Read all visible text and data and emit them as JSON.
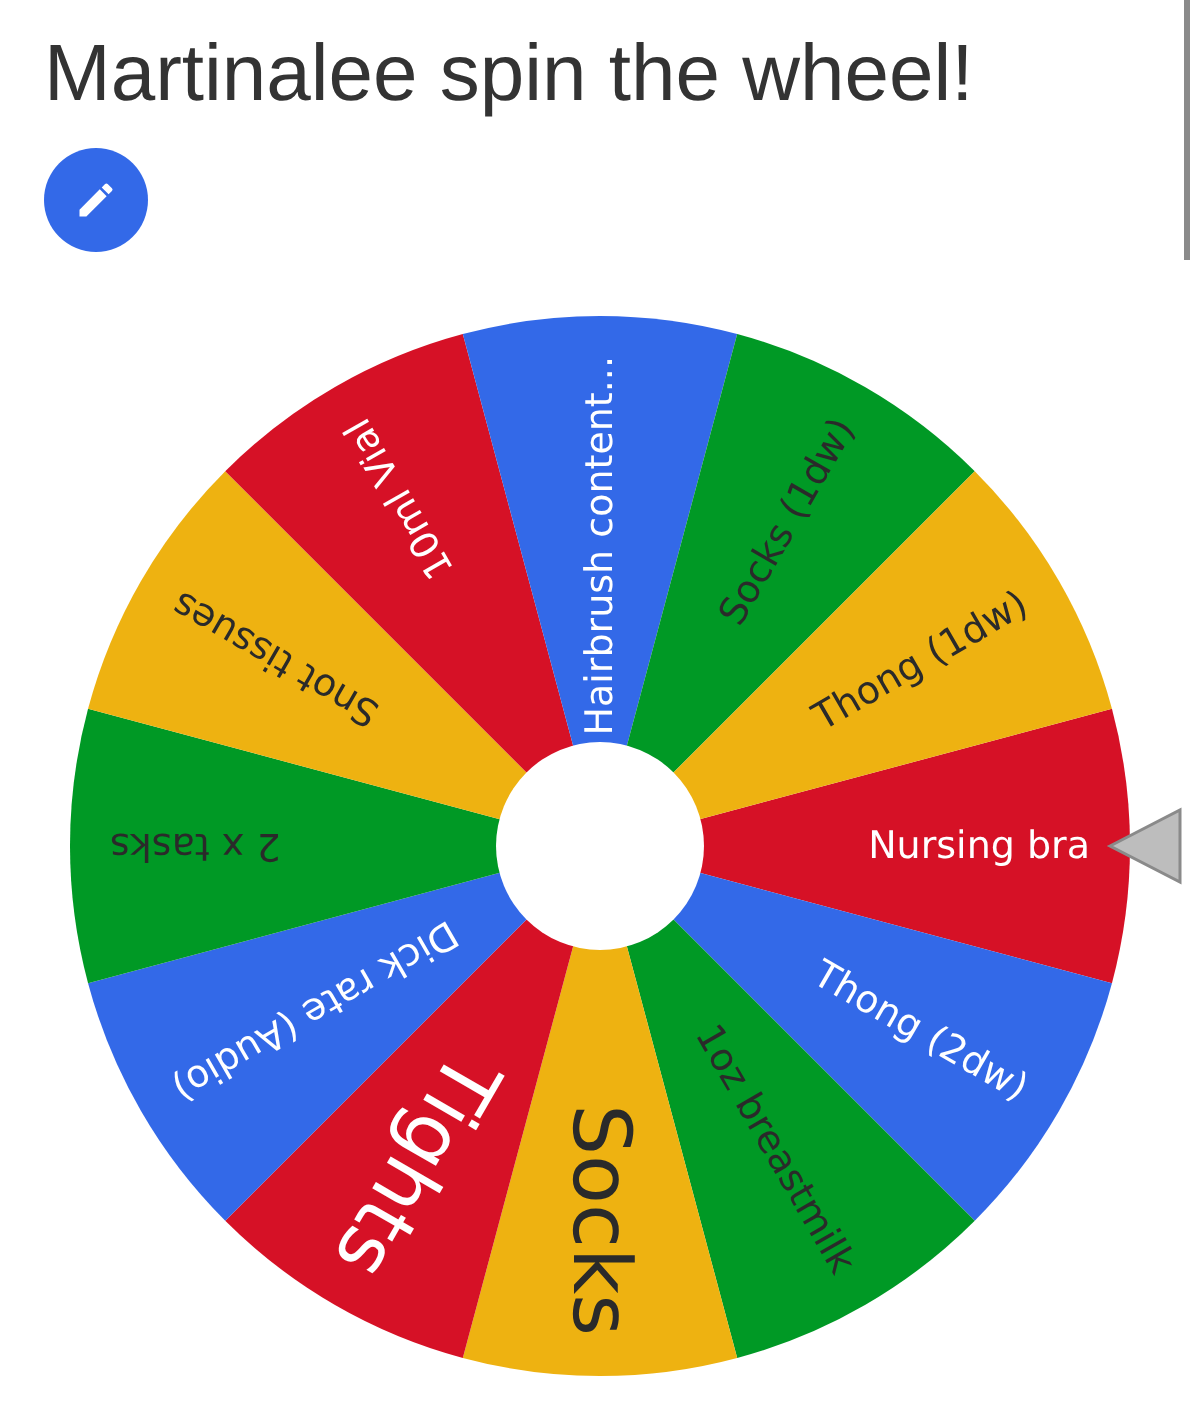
{
  "title": "Martinalee spin the wheel!",
  "wheel": {
    "segments": [
      {
        "label": "Nursing bra",
        "color": "#d61126",
        "kind": "normal"
      },
      {
        "label": "Thong (2dw)",
        "color": "#3369e8",
        "kind": "normal"
      },
      {
        "label": "1oz breastmilk",
        "color": "#009925",
        "kind": "normal"
      },
      {
        "label": "Socks",
        "color": "#eeb211",
        "kind": "large"
      },
      {
        "label": "Tights",
        "color": "#d61126",
        "kind": "large"
      },
      {
        "label": "Dick rate (Audio)",
        "color": "#3369e8",
        "kind": "normal"
      },
      {
        "label": "2 x tasks",
        "color": "#009925",
        "kind": "normal"
      },
      {
        "label": "Snot tissues",
        "color": "#eeb211",
        "kind": "normal"
      },
      {
        "label": "10ml Vial",
        "color": "#d61126",
        "kind": "normal"
      },
      {
        "label": "Hairbrush content...",
        "color": "#3369e8",
        "kind": "normal"
      },
      {
        "label": "Socks (1dw)",
        "color": "#009925",
        "kind": "normal"
      },
      {
        "label": "Thong (1dw)",
        "color": "#eeb211",
        "kind": "normal"
      }
    ]
  }
}
